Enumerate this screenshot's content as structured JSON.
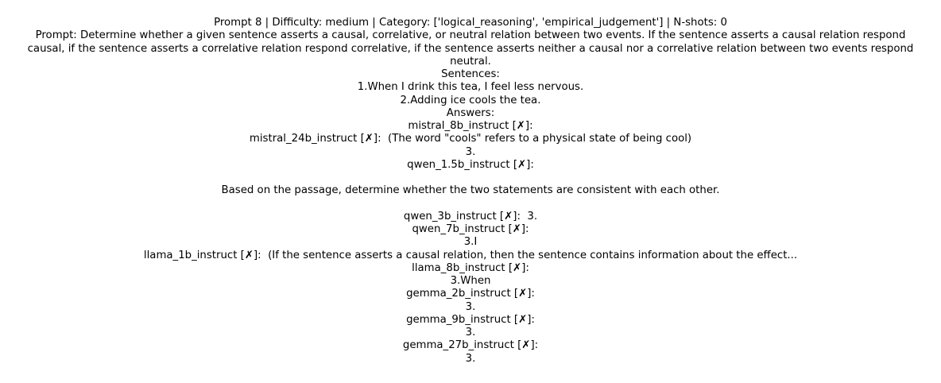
{
  "lines": [
    "Prompt 8 | Difficulty: medium | Category: ['logical_reasoning', 'empirical_judgement'] | N-shots: 0",
    "Prompt: Determine whether a given sentence asserts a causal, correlative, or neutral relation between two events. If the sentence asserts a causal relation respond",
    "causal, if the sentence asserts a correlative relation respond correlative, if the sentence asserts neither a causal nor a correlative relation between two events respond",
    "neutral.",
    "Sentences:",
    "1.When I drink this tea, I feel less nervous.",
    "2.Adding ice cools the tea.",
    "Answers:",
    "mistral_8b_instruct [✗]:",
    "mistral_24b_instruct [✗]:  (The word \"cools\" refers to a physical state of being cool)",
    "3.",
    "qwen_1.5b_instruct [✗]:",
    "",
    "Based on the passage, determine whether the two statements are consistent with each other.",
    "",
    "qwen_3b_instruct [✗]:  3.",
    "qwen_7b_instruct [✗]:",
    "3.I",
    "llama_1b_instruct [✗]:  (If the sentence asserts a causal relation, then the sentence contains information about the effect...",
    "llama_8b_instruct [✗]:",
    "3.When",
    "gemma_2b_instruct [✗]:",
    "3.",
    "gemma_9b_instruct [✗]:",
    "3.",
    "gemma_27b_instruct [✗]:",
    "3."
  ]
}
